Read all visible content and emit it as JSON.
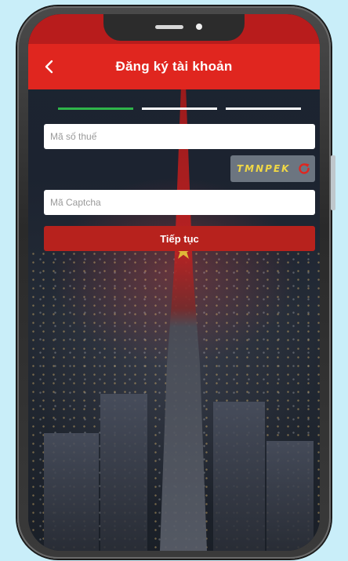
{
  "header": {
    "title": "Đăng ký tài khoản",
    "back_icon": "chevron-left-icon"
  },
  "steps": {
    "total": 3,
    "current": 1
  },
  "form": {
    "tax_code": {
      "placeholder": "Mã số thuế",
      "value": ""
    },
    "captcha": {
      "code": "TMNPEK",
      "placeholder": "Mã Captcha",
      "value": "",
      "refresh_icon": "refresh-icon"
    },
    "submit_label": "Tiếp tục"
  },
  "colors": {
    "header": "#e0261f",
    "submit": "#b7221d",
    "step_active": "#2fb54a",
    "step_inactive": "#ffffff",
    "captcha_text": "#f1d845"
  }
}
